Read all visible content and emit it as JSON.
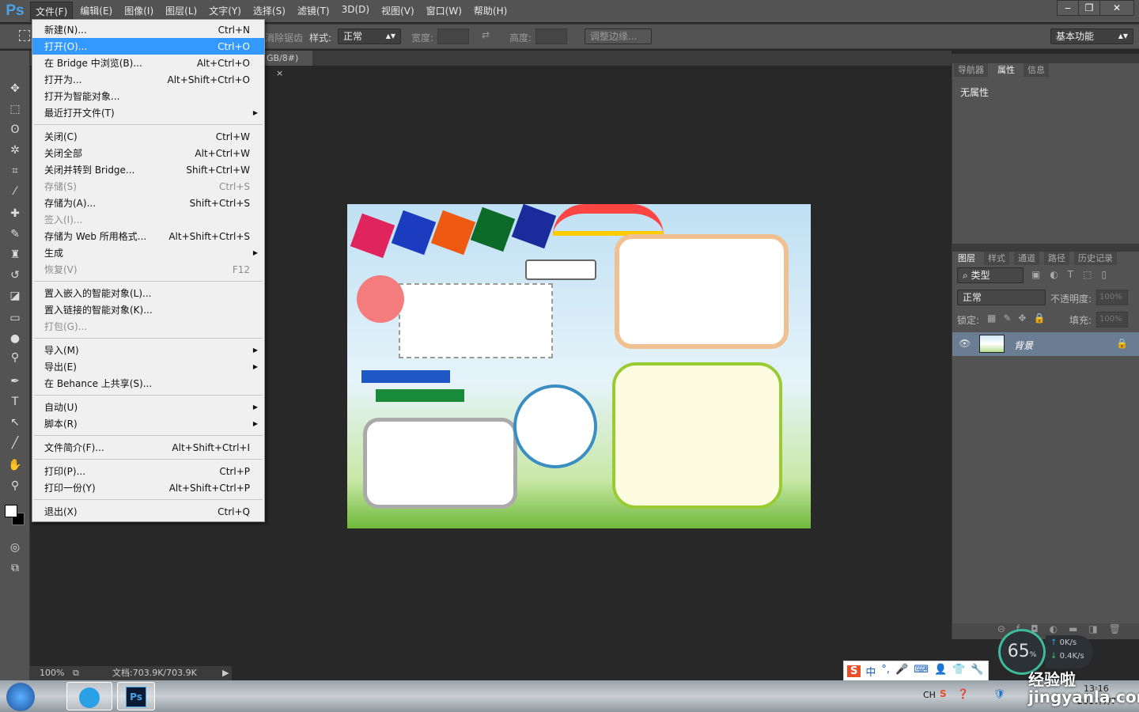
{
  "app": {
    "logo": "Ps",
    "menus": [
      "文件(F)",
      "编辑(E)",
      "图像(I)",
      "图层(L)",
      "文字(Y)",
      "选择(S)",
      "滤镜(T)",
      "3D(D)",
      "视图(V)",
      "窗口(W)",
      "帮助(H)"
    ],
    "active_menu": 0
  },
  "window_controls": {
    "minimize": "‒",
    "restore": "❐",
    "close": "✕"
  },
  "options": {
    "antialias": "消除锯齿",
    "style_label": "样式:",
    "style_value": "正常",
    "width_label": "宽度:",
    "height_label": "高度:",
    "refine_edge": "调整边缘...",
    "workspace": "基本功能"
  },
  "document_tab": {
    "title": "GB/8#)",
    "close": "×"
  },
  "file_menu": [
    {
      "label": "新建(N)...",
      "shortcut": "Ctrl+N"
    },
    {
      "label": "打开(O)...",
      "shortcut": "Ctrl+O",
      "highlighted": true
    },
    {
      "label": "在 Bridge 中浏览(B)...",
      "shortcut": "Alt+Ctrl+O"
    },
    {
      "label": "打开为...",
      "shortcut": "Alt+Shift+Ctrl+O"
    },
    {
      "label": "打开为智能对象...",
      "shortcut": ""
    },
    {
      "label": "最近打开文件(T)",
      "shortcut": "",
      "submenu": true
    },
    {
      "separator": true
    },
    {
      "label": "关闭(C)",
      "shortcut": "Ctrl+W"
    },
    {
      "label": "关闭全部",
      "shortcut": "Alt+Ctrl+W"
    },
    {
      "label": "关闭并转到 Bridge...",
      "shortcut": "Shift+Ctrl+W"
    },
    {
      "label": "存储(S)",
      "shortcut": "Ctrl+S",
      "disabled": true
    },
    {
      "label": "存储为(A)...",
      "shortcut": "Shift+Ctrl+S"
    },
    {
      "label": "签入(I)...",
      "shortcut": "",
      "disabled": true
    },
    {
      "label": "存储为 Web 所用格式...",
      "shortcut": "Alt+Shift+Ctrl+S"
    },
    {
      "label": "生成",
      "shortcut": "",
      "submenu": true
    },
    {
      "label": "恢复(V)",
      "shortcut": "F12",
      "disabled": true
    },
    {
      "separator": true
    },
    {
      "label": "置入嵌入的智能对象(L)...",
      "shortcut": ""
    },
    {
      "label": "置入链接的智能对象(K)...",
      "shortcut": ""
    },
    {
      "label": "打包(G)...",
      "shortcut": "",
      "disabled": true
    },
    {
      "separator": true
    },
    {
      "label": "导入(M)",
      "shortcut": "",
      "submenu": true
    },
    {
      "label": "导出(E)",
      "shortcut": "",
      "submenu": true
    },
    {
      "label": "在 Behance 上共享(S)...",
      "shortcut": ""
    },
    {
      "separator": true
    },
    {
      "label": "自动(U)",
      "shortcut": "",
      "submenu": true
    },
    {
      "label": "脚本(R)",
      "shortcut": "",
      "submenu": true
    },
    {
      "separator": true
    },
    {
      "label": "文件简介(F)...",
      "shortcut": "Alt+Shift+Ctrl+I"
    },
    {
      "separator": true
    },
    {
      "label": "打印(P)...",
      "shortcut": "Ctrl+P"
    },
    {
      "label": "打印一份(Y)",
      "shortcut": "Alt+Shift+Ctrl+P"
    },
    {
      "separator": true
    },
    {
      "label": "退出(X)",
      "shortcut": "Ctrl+Q"
    }
  ],
  "properties_panel": {
    "tabs": [
      "导航器",
      "属性",
      "信息"
    ],
    "active": 1,
    "content": "无属性"
  },
  "layers_panel": {
    "tabs": [
      "图层",
      "样式",
      "通道",
      "路径",
      "历史记录"
    ],
    "active": 0,
    "filter": "类型",
    "blend_mode": "正常",
    "opacity_label": "不透明度:",
    "opacity": "100%",
    "lock_label": "锁定:",
    "fill_label": "填充:",
    "fill": "100%",
    "layers": [
      {
        "name": "背景",
        "visible": true,
        "locked": true
      }
    ]
  },
  "status": {
    "zoom": "100%",
    "doc": "文档:703.9K/703.9K"
  },
  "net_widget": {
    "percent": "65",
    "unit": "%",
    "up": "0K/s",
    "down": "0.4K/s"
  },
  "ime": {
    "items": [
      "中",
      "°,",
      "🎤",
      "⌨",
      "👤",
      "👕",
      "🔧"
    ]
  },
  "tray": {
    "lang": "CH",
    "time": "13:16",
    "date": "2017/7/7"
  },
  "watermark": "经验啦 jingyanla.com"
}
